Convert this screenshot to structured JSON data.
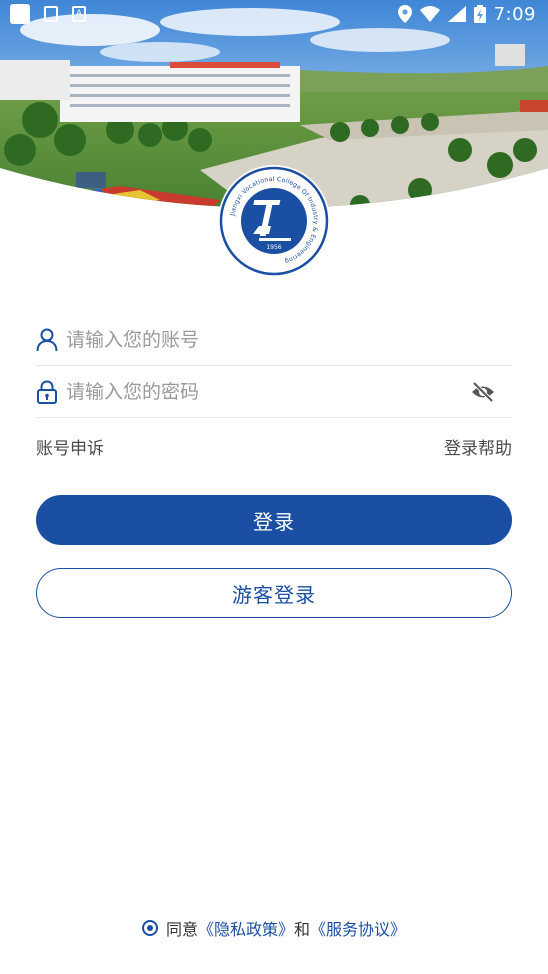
{
  "status_bar": {
    "time": "7:09",
    "icons": [
      "notification-square-icon",
      "sim-card-icon",
      "text-a-icon",
      "location-icon",
      "wifi-icon",
      "signal-icon",
      "battery-charging-icon"
    ]
  },
  "header": {
    "emblem_year": "1956",
    "emblem_motto": "Jiangxi Vocational College Of Industry & Engineering"
  },
  "login_form": {
    "account_placeholder": "请输入您的账号",
    "password_placeholder": "请输入您的密码",
    "account_appeal_label": "账号申诉",
    "login_help_label": "登录帮助",
    "login_button_label": "登录",
    "guest_login_button_label": "游客登录"
  },
  "agreement": {
    "prefix": "同意",
    "privacy_policy_link": "《隐私政策》",
    "conjunction": "和",
    "service_agreement_link": "《服务协议》"
  },
  "colors": {
    "primary": "#1b4fa3",
    "placeholder": "#9a9a9a",
    "divider": "#e6e6e6"
  }
}
